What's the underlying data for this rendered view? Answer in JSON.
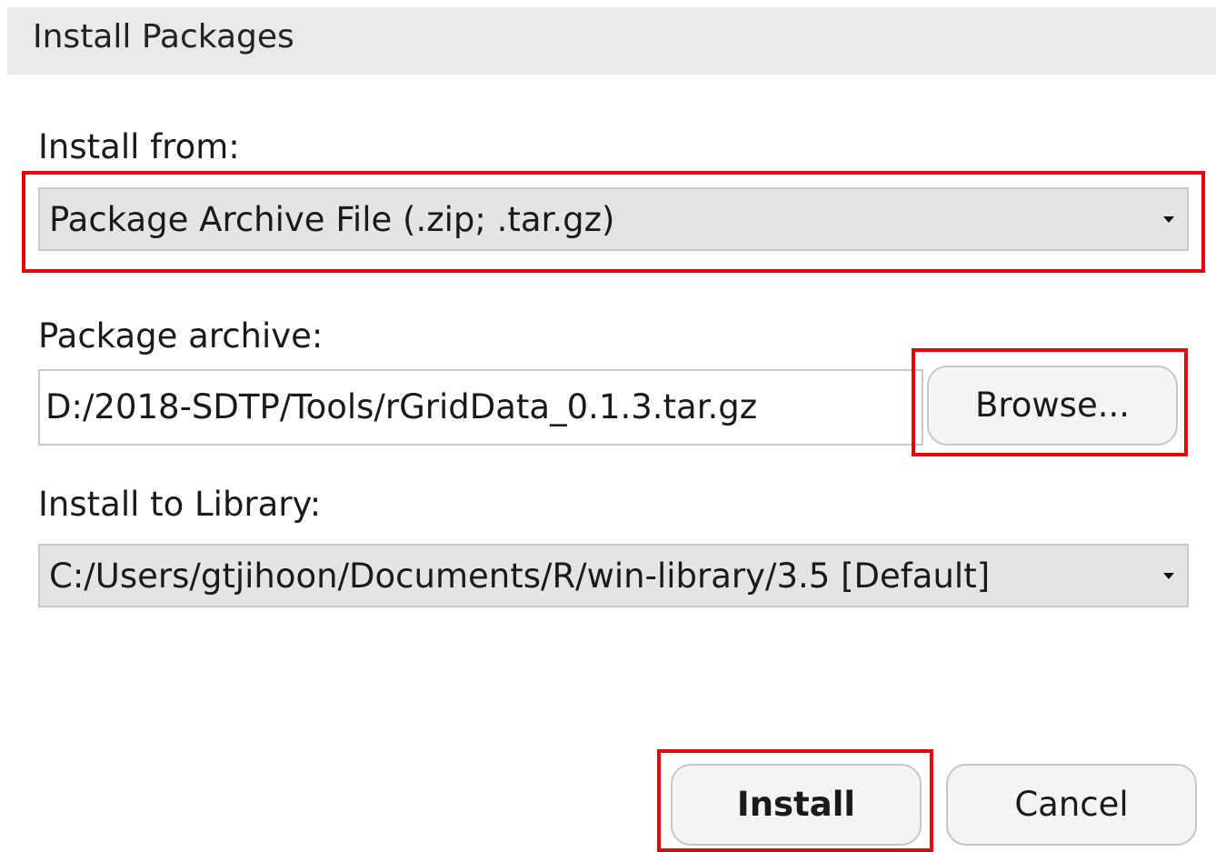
{
  "window": {
    "title": "Install Packages"
  },
  "install_from": {
    "label": "Install from:",
    "selected": "Package Archive File (.zip; .tar.gz)"
  },
  "package_archive": {
    "label": "Package archive:",
    "value": "D:/2018-SDTP/Tools/rGridData_0.1.3.tar.gz",
    "browse_label": "Browse..."
  },
  "install_to_library": {
    "label": "Install to Library:",
    "selected": "C:/Users/gtjihoon/Documents/R/win-library/3.5 [Default]"
  },
  "buttons": {
    "install_label": "Install",
    "cancel_label": "Cancel"
  },
  "colors": {
    "highlight": "#e8000b",
    "titlebar": "#e9e9e9",
    "select_bg": "#e4e4e4"
  },
  "icons": {
    "dropdown": "caret-down-icon"
  }
}
